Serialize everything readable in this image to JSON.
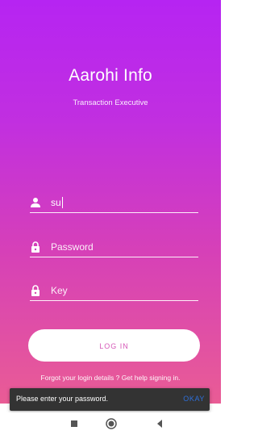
{
  "app": {
    "title": "Aarohi Info",
    "subtitle": "Transaction Executive"
  },
  "form": {
    "username_value": "su",
    "password_placeholder": "Password",
    "key_placeholder": "Key",
    "login_label": "LOG IN",
    "forgot_text": "Forgot your login details ? Get help signing in."
  },
  "snackbar": {
    "message": "Please enter your password.",
    "action_label": "OKAY"
  },
  "colors": {
    "gradient_top": "#b624f2",
    "gradient_bottom": "#e95c95",
    "snackbar_bg": "#333333",
    "snackbar_action": "#2e6fd8"
  },
  "icons": {
    "username": "person-icon",
    "password": "lock-icon",
    "key": "lock-icon",
    "nav_recents": "square-icon",
    "nav_home": "circle-icon",
    "nav_back": "triangle-back-icon"
  }
}
